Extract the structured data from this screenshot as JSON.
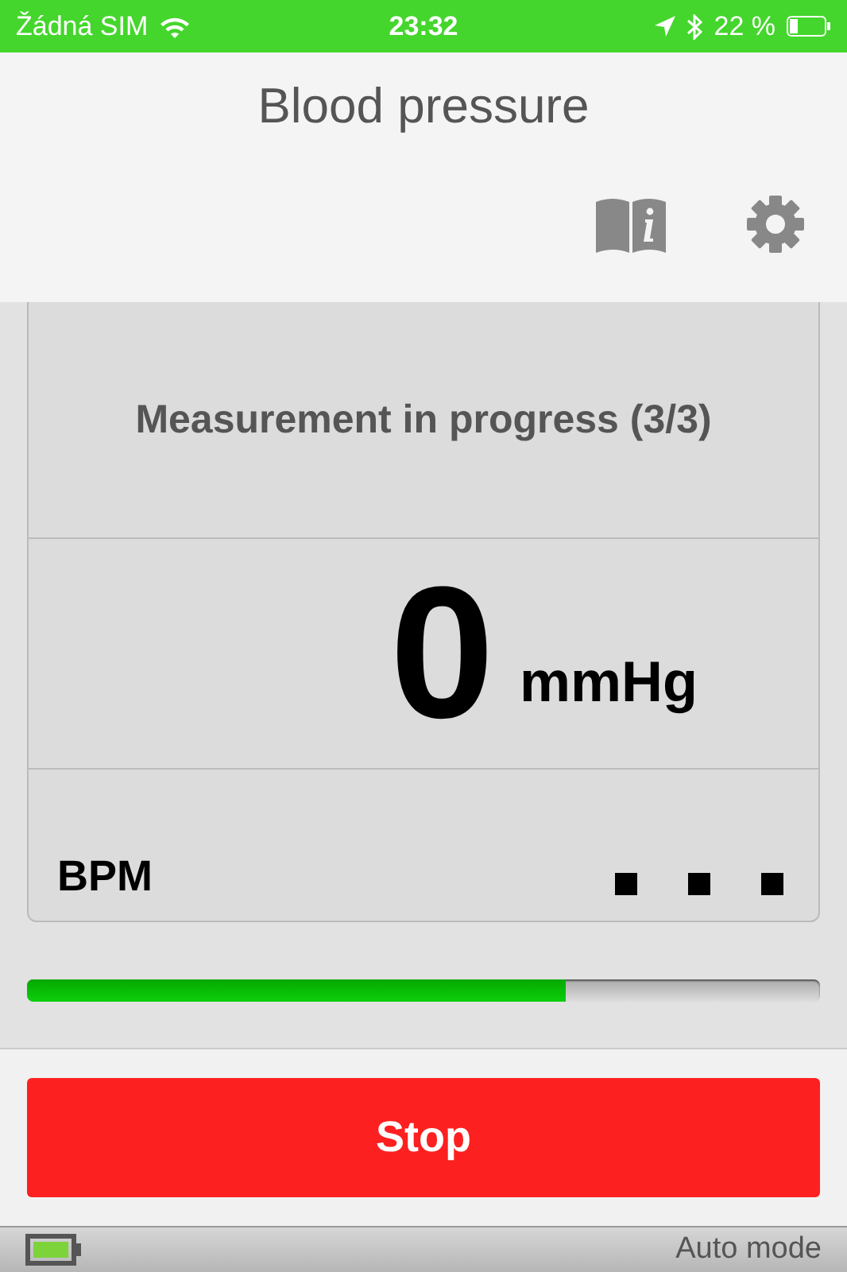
{
  "status_bar": {
    "carrier": "Žádná SIM",
    "time": "23:32",
    "battery_percent": "22 %"
  },
  "header": {
    "title": "Blood pressure"
  },
  "measurement": {
    "status": "Measurement in progress (3/3)",
    "value": "0",
    "unit": "mmHg",
    "pulse_label": "BPM"
  },
  "progress": {
    "level": 0.68
  },
  "stop_button": {
    "label": "Stop"
  },
  "footer": {
    "mode": "Auto mode"
  }
}
